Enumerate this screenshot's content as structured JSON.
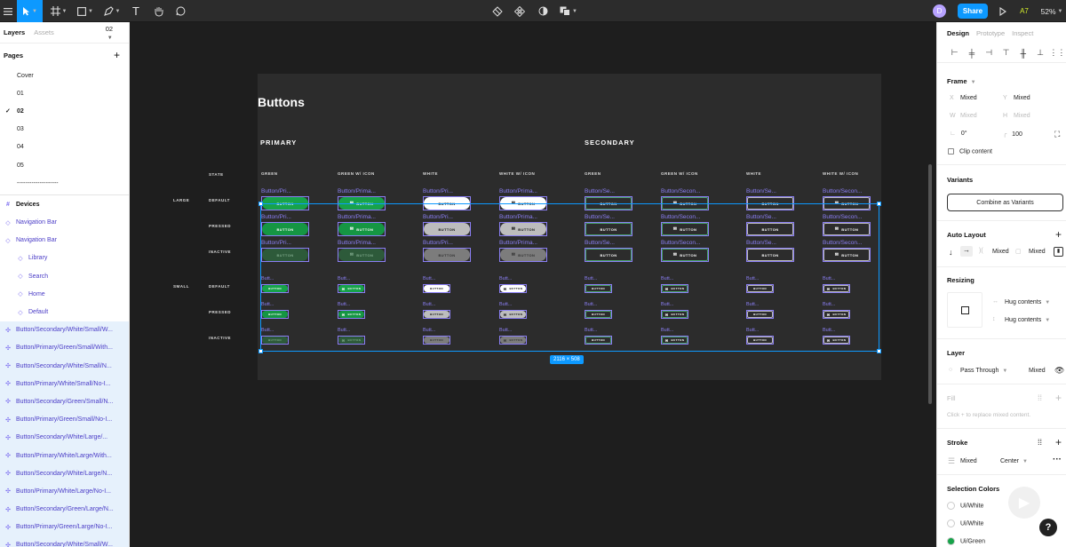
{
  "toolbar": {
    "zoom": "52%",
    "share_label": "Share",
    "avatar_initial": "D",
    "user_tag": "A7"
  },
  "left_panel": {
    "tabs": [
      "Layers",
      "Assets"
    ],
    "page_indicator": "02",
    "pages_header": "Pages",
    "pages": [
      "Cover",
      "01",
      "02",
      "03",
      "04",
      "05",
      "--------------------"
    ],
    "current_page": "02",
    "layers": [
      {
        "name": "Devices",
        "kind": "frame"
      },
      {
        "name": "Navigation Bar",
        "kind": "component"
      },
      {
        "name": "Navigation Bar",
        "kind": "component"
      },
      {
        "name": "Library",
        "kind": "instance"
      },
      {
        "name": "Search",
        "kind": "instance"
      },
      {
        "name": "Home",
        "kind": "instance"
      },
      {
        "name": "Default",
        "kind": "instance"
      },
      {
        "name": "Button/Secondary/White/Small/W...",
        "kind": "selected"
      },
      {
        "name": "Button/Primary/Green/Small/With...",
        "kind": "selected"
      },
      {
        "name": "Button/Secondary/White/Small/N...",
        "kind": "selected"
      },
      {
        "name": "Button/Primary/White/Small/No-I...",
        "kind": "selected"
      },
      {
        "name": "Button/Secondary/Green/Small/N...",
        "kind": "selected"
      },
      {
        "name": "Button/Primary/Green/Small/No-I...",
        "kind": "selected"
      },
      {
        "name": "Button/Secondary/White/Large/...",
        "kind": "selected"
      },
      {
        "name": "Button/Primary/White/Large/With...",
        "kind": "selected"
      },
      {
        "name": "Button/Secondary/White/Large/N...",
        "kind": "selected"
      },
      {
        "name": "Button/Primary/White/Large/No-I...",
        "kind": "selected"
      },
      {
        "name": "Button/Secondary/Green/Large/N...",
        "kind": "selected"
      },
      {
        "name": "Button/Primary/Green/Large/No-I...",
        "kind": "selected"
      },
      {
        "name": "Button/Secondary/White/Small/W...",
        "kind": "selected"
      }
    ]
  },
  "canvas": {
    "board_title": "Buttons",
    "section_primary": "PRIMARY",
    "section_secondary": "SECONDARY",
    "state_label": "STATE",
    "columns": [
      "GREEN",
      "GREEN W/ ICON",
      "WHITE",
      "WHITE W/ ICON",
      "GREEN",
      "GREEN W/ ICON",
      "WHITE",
      "WHITE W/ ICON"
    ],
    "sizes": [
      "LARGE",
      "SMALL"
    ],
    "states": [
      "DEFAULT",
      "PRESSED",
      "INACTIVE"
    ],
    "button_text": "BUTTON",
    "large_names": [
      "Button/Pri...",
      "Button/Prima...",
      "Button/Pri...",
      "Button/Prima...",
      "Button/Se...",
      "Button/Secon...",
      "Button/Se...",
      "Button/Secon..."
    ],
    "small_name": "Butt...",
    "selection_size": "2116 × 508",
    "colors": {
      "green": "#17a34a",
      "green_dim": "#2d5a3a",
      "white": "#ffffff",
      "white_pressed": "#bdbdbd",
      "white_inactive": "#7c7c7c",
      "selection": "#0d99ff",
      "component": "#8b7ff5"
    }
  },
  "right_panel": {
    "tabs": [
      "Design",
      "Prototype",
      "Inspect"
    ],
    "frame_label": "Frame",
    "x_label": "X",
    "x_value": "Mixed",
    "y_label": "Y",
    "y_value": "Mixed",
    "w_label": "W",
    "w_value": "Mixed",
    "h_label": "H",
    "h_value": "Mixed",
    "rotation": "0°",
    "radius": "100",
    "clip_content": "Clip content",
    "variants_label": "Variants",
    "combine_label": "Combine as Variants",
    "auto_layout_label": "Auto Layout",
    "auto_spacing": "Mixed",
    "auto_padding": "Mixed",
    "resizing_label": "Resizing",
    "hug_h": "Hug contents",
    "hug_v": "Hug contents",
    "layer_label": "Layer",
    "blend_mode": "Pass Through",
    "opacity": "Mixed",
    "fill_label": "Fill",
    "fill_hint": "Click + to replace mixed content.",
    "stroke_label": "Stroke",
    "stroke_value": "Mixed",
    "stroke_align": "Center",
    "selection_colors_label": "Selection Colors",
    "selection_colors": [
      {
        "name": "Ui/White",
        "hex": "#ffffff"
      },
      {
        "name": "Ui/White",
        "hex": "#ffffff"
      },
      {
        "name": "Ui/Green",
        "hex": "#17a34a"
      }
    ],
    "help_label": "?"
  }
}
